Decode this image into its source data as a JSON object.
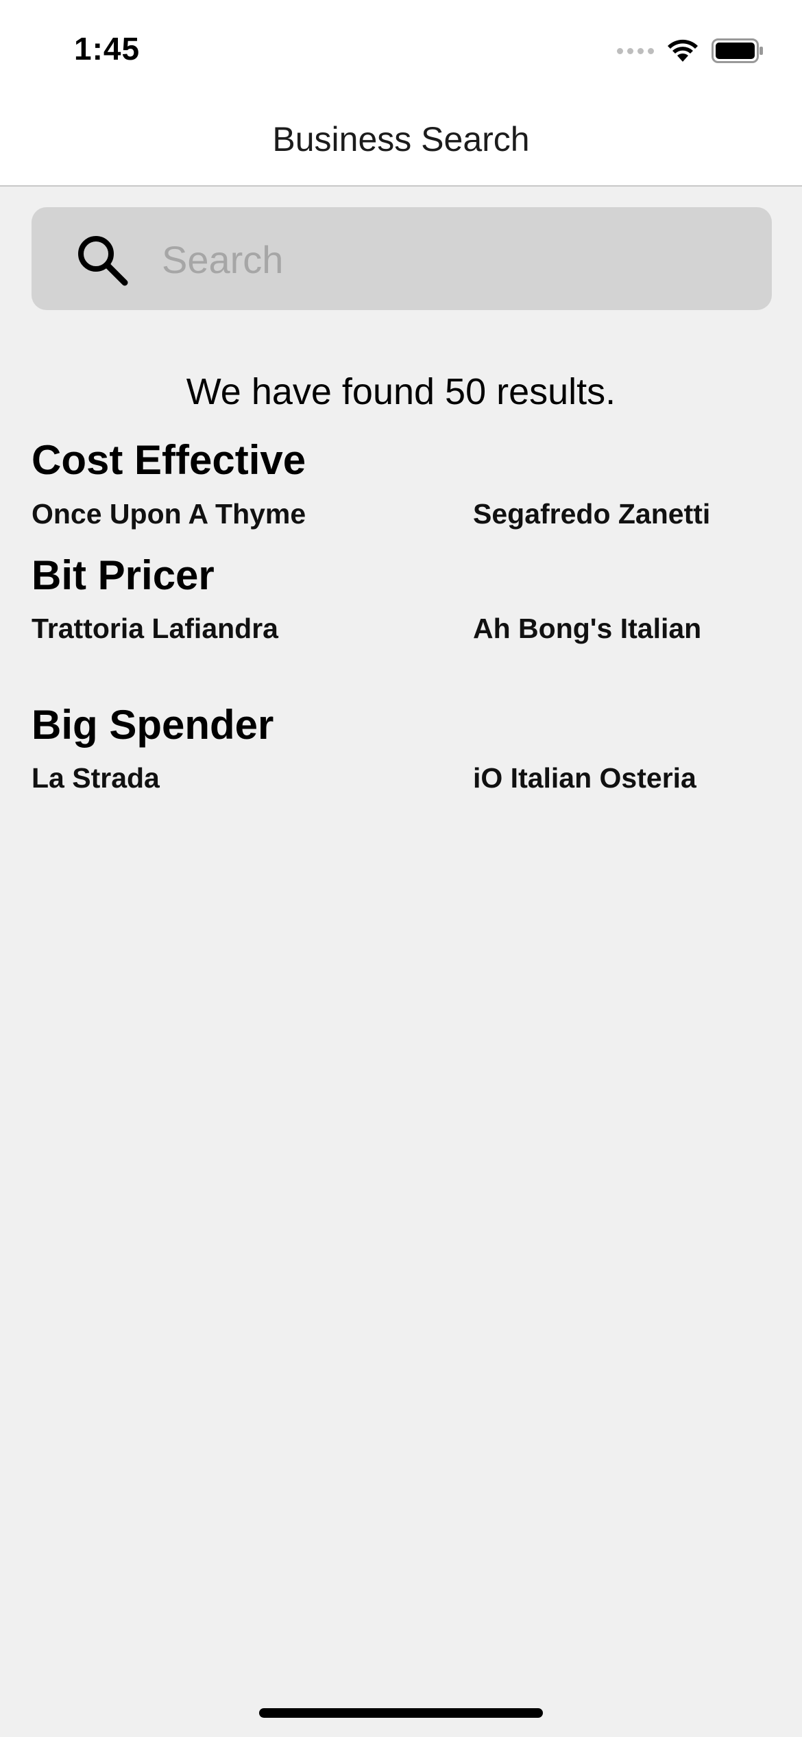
{
  "status_bar": {
    "time": "1:45",
    "icons": [
      "cellular-signal-icon",
      "wifi-icon",
      "battery-icon"
    ]
  },
  "nav": {
    "title": "Business Search"
  },
  "search": {
    "placeholder": "Search",
    "value": "",
    "icon": "search-icon"
  },
  "results": {
    "summary": "We have found 50 results."
  },
  "sections": [
    {
      "title": "Cost Effective",
      "businesses": [
        "Once Upon A Thyme",
        "Segafredo Zanetti"
      ]
    },
    {
      "title": "Bit Pricer",
      "businesses": [
        "Trattoria Lafiandra",
        "Ah Bong's Italian"
      ]
    },
    {
      "title": "Big Spender",
      "businesses": [
        "La Strada",
        "iO Italian Osteria"
      ]
    }
  ]
}
